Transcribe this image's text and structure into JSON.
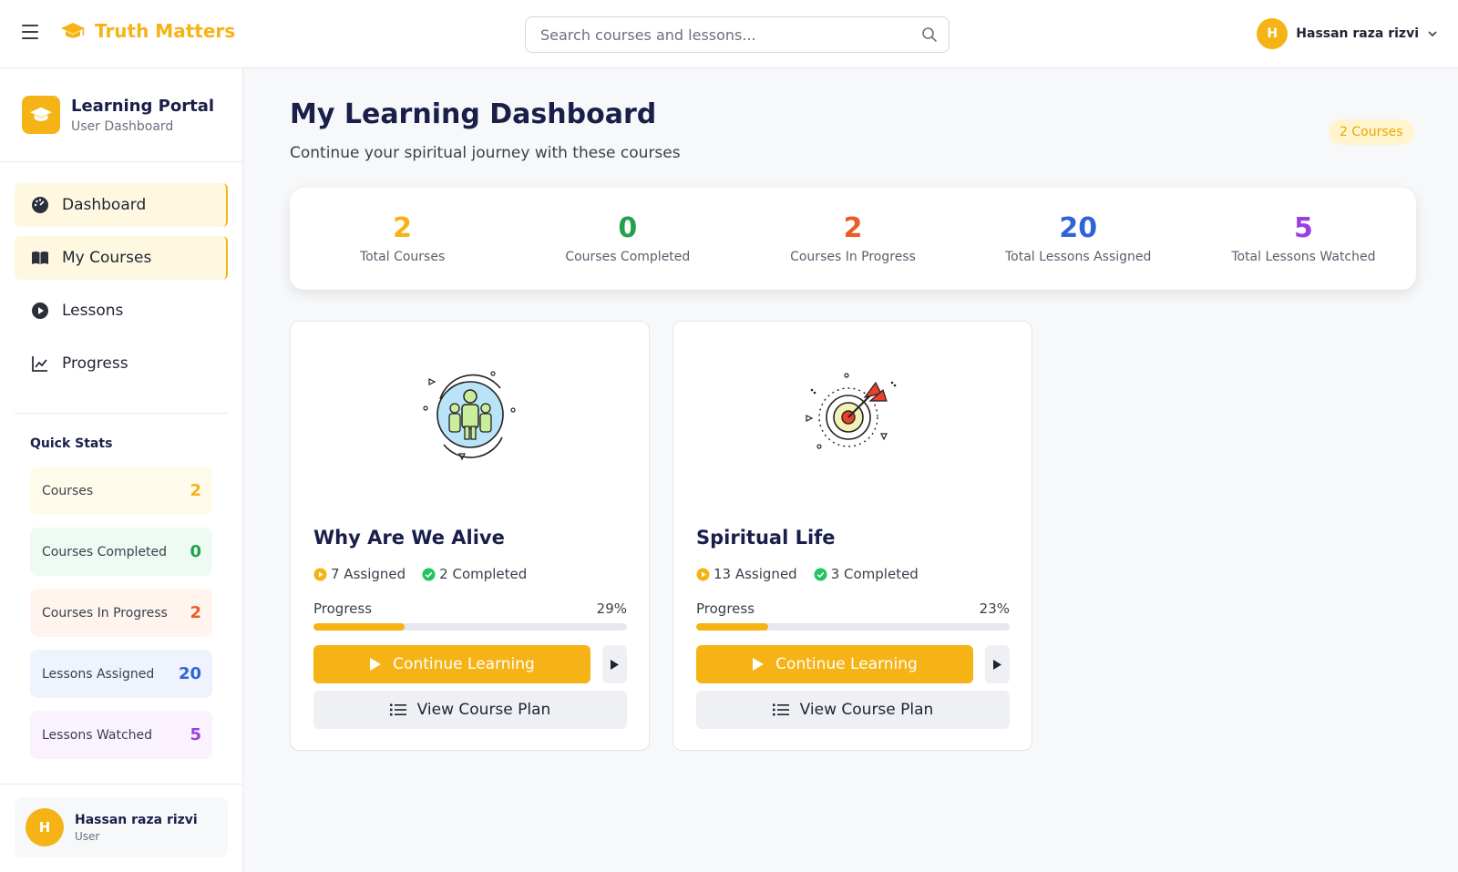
{
  "app": {
    "title": "Truth Matters"
  },
  "search": {
    "placeholder": "Search courses and lessons..."
  },
  "user": {
    "name": "Hassan raza rizvi",
    "initial": "H",
    "role": "User"
  },
  "sidebar": {
    "portal_title": "Learning Portal",
    "portal_subtitle": "User Dashboard",
    "nav": [
      {
        "label": "Dashboard",
        "icon": "dashboard-gauge-icon",
        "active": true
      },
      {
        "label": "My Courses",
        "icon": "book-icon",
        "active": true
      },
      {
        "label": "Lessons",
        "icon": "play-circle-icon",
        "active": false
      },
      {
        "label": "Progress",
        "icon": "line-chart-icon",
        "active": false
      }
    ],
    "quick_stats_title": "Quick Stats",
    "quick_stats": [
      {
        "label": "Courses",
        "value": "2",
        "color": "#f5b316",
        "bg": "#fffbea"
      },
      {
        "label": "Courses Completed",
        "value": "0",
        "color": "#22a04b",
        "bg": "#effaf2"
      },
      {
        "label": "Courses In Progress",
        "value": "2",
        "color": "#ec5b24",
        "bg": "#fff5ee"
      },
      {
        "label": "Lessons Assigned",
        "value": "20",
        "color": "#2f63d9",
        "bg": "#eef3fd"
      },
      {
        "label": "Lessons Watched",
        "value": "5",
        "color": "#9a3ee8",
        "bg": "#faf2fe"
      }
    ]
  },
  "main": {
    "title": "My Learning Dashboard",
    "subtitle": "Continue your spiritual journey with these courses",
    "course_count_badge": "2 Courses",
    "stats": [
      {
        "value": "2",
        "label": "Total Courses",
        "color": "#f5b316"
      },
      {
        "value": "0",
        "label": "Courses Completed",
        "color": "#22a04b"
      },
      {
        "value": "2",
        "label": "Courses In Progress",
        "color": "#ec5b24"
      },
      {
        "value": "20",
        "label": "Total Lessons Assigned",
        "color": "#2f63d9"
      },
      {
        "value": "5",
        "label": "Total Lessons Watched",
        "color": "#9a3ee8"
      }
    ],
    "courses": [
      {
        "title": "Why Are We Alive",
        "assigned": "7 Assigned",
        "completed": "2 Completed",
        "progress_label": "Progress",
        "progress_text": "29%",
        "progress": 0.29,
        "illustration": "people-circle-icon",
        "continue_label": "Continue Learning",
        "plan_label": "View Course Plan"
      },
      {
        "title": "Spiritual Life",
        "assigned": "13 Assigned",
        "completed": "3 Completed",
        "progress_label": "Progress",
        "progress_text": "23%",
        "progress": 0.23,
        "illustration": "target-arrow-icon",
        "continue_label": "Continue Learning",
        "plan_label": "View Course Plan"
      }
    ]
  },
  "colors": {
    "accent": "#f5b316",
    "navy": "#1a1f4a",
    "success": "#22c55e"
  }
}
